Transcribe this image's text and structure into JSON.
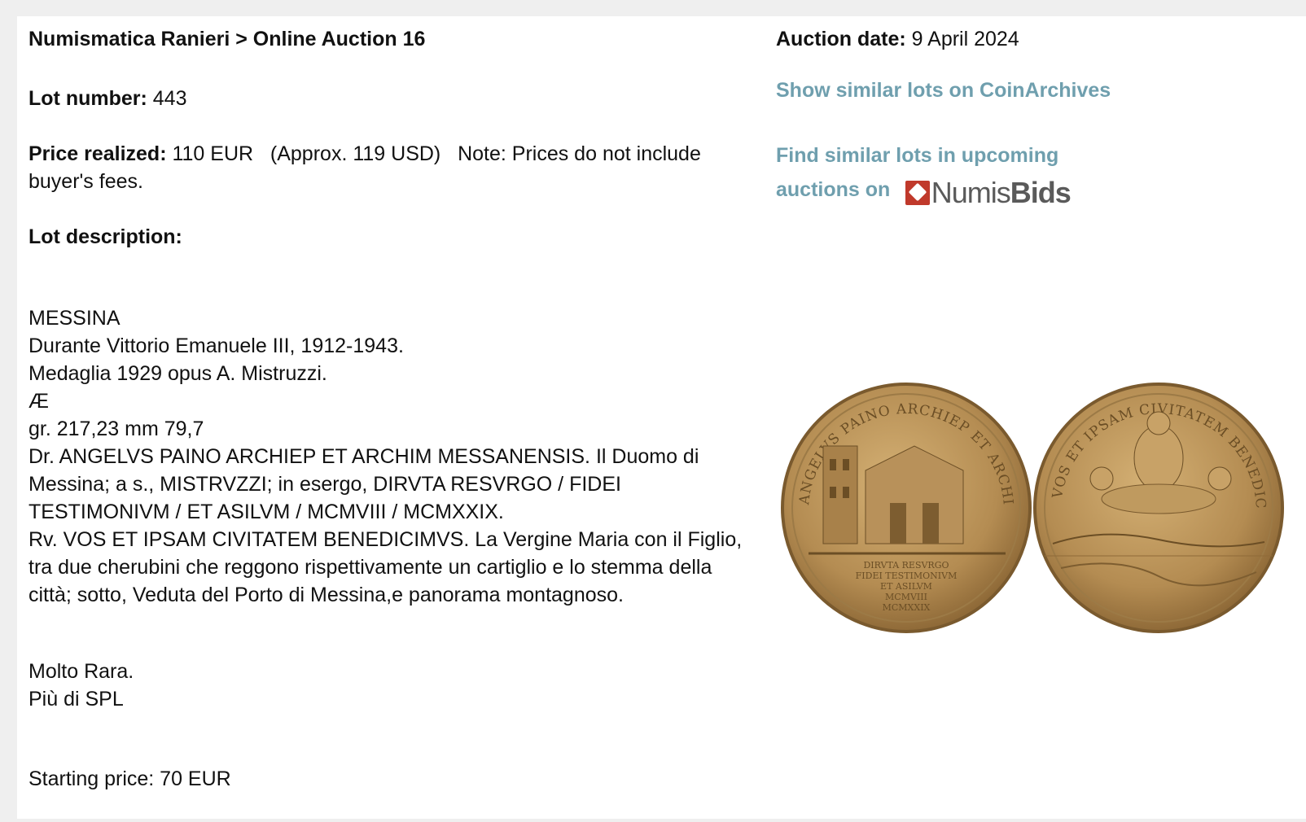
{
  "header": {
    "breadcrumb": "Numismatica Ranieri > Online Auction 16",
    "auction_date_label": "Auction date:",
    "auction_date_value": "9 April 2024"
  },
  "lot": {
    "number_label": "Lot number:",
    "number_value": "443",
    "price_label": "Price realized:",
    "price_value": "110 EUR   (Approx. 119 USD)   Note: Prices do not include buyer's fees.",
    "description_label": "Lot description:",
    "description_lines": [
      "MESSINA",
      "Durante Vittorio Emanuele III, 1912-1943.",
      "Medaglia 1929 opus A. Mistruzzi.",
      "Æ",
      "gr. 217,23 mm 79,7",
      "Dr. ANGELVS PAINO ARCHIEP ET ARCHIM MESSANENSIS. Il Duomo di Messina; a s., MISTRVZZI; in esergo, DIRVTA RESVRGO / FIDEI TESTIMONIVM / ET ASILVM / MCMVIII / MCMXXIX.",
      "Rv. VOS ET IPSAM CIVITATEM BENEDICIMVS. La Vergine Maria con il Figlio, tra due cherubini che reggono rispettivamente un cartiglio e lo stemma della città; sotto, Veduta del Porto di Messina,e panorama montagnoso."
    ],
    "rarity": "Molto Rara.",
    "grade": "Più di SPL",
    "starting_price": "Starting price: 70 EUR"
  },
  "links": {
    "coinarchives": "Show similar lots on CoinArchives",
    "numisbids_prefix": "Find similar lots in upcoming auctions on",
    "numisbids_logo_a": "Numis",
    "numisbids_logo_b": "Bids"
  },
  "medal": {
    "obverse_legend": "ANGELVS PAINO ARCHIEP ET ARCHIM MESSANENSIS",
    "exergue": [
      "DIRVTA RESVRGO",
      "FIDEI TESTIMONIVM",
      "ET ASILVM",
      "MCMVIII",
      "MCMXXIX"
    ],
    "reverse_legend": "VOS ET IPSAM CIVITATEM BENEDICIMVS"
  },
  "colors": {
    "link": "#6f9fae",
    "bronze": "#b08a4e",
    "logo_red": "#c0392b"
  }
}
